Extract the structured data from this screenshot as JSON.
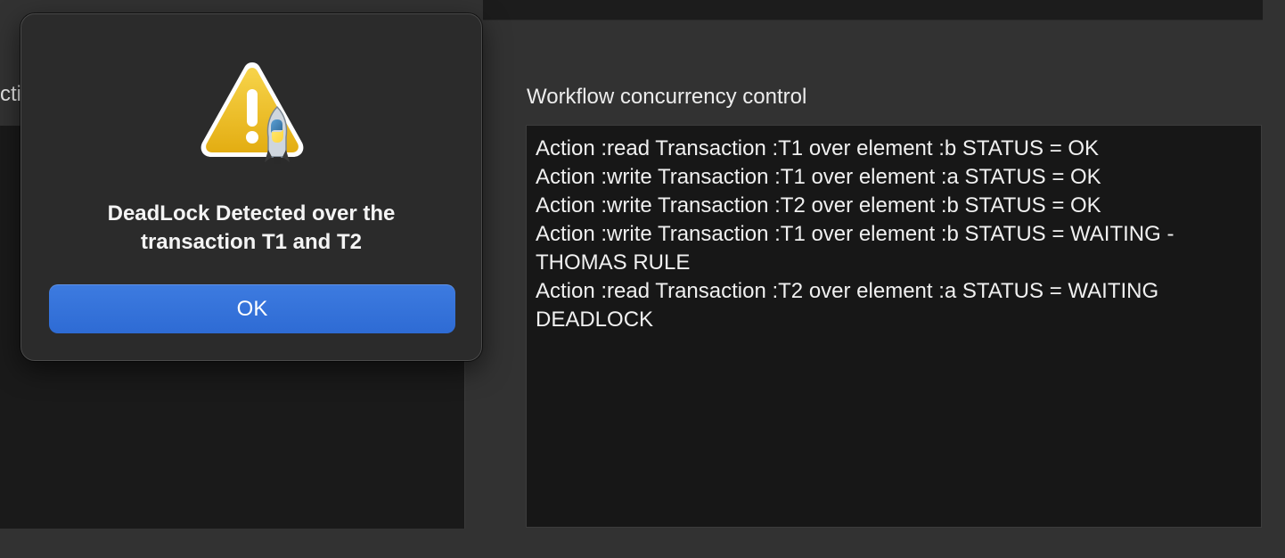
{
  "background_panel": {
    "left_label_partial": "cti",
    "title": "Workflow concurrency control"
  },
  "log": {
    "lines": [
      "Action :read Transaction :T1 over element :b STATUS = OK",
      "Action :write Transaction :T1 over element :a STATUS = OK",
      "Action :write Transaction :T2 over element :b STATUS = OK",
      "Action :write Transaction :T1 over element :b STATUS = WAITING - THOMAS RULE",
      "Action :read Transaction :T2 over element :a STATUS = WAITING DEADLOCK"
    ]
  },
  "dialog": {
    "icon": "warning-icon",
    "message": "DeadLock Detected over the transaction T1 and T2",
    "ok_label": "OK"
  },
  "colors": {
    "accent": "#2e6bd4",
    "warning_yellow": "#f0c419",
    "background": "#323232",
    "panel": "#171717"
  }
}
